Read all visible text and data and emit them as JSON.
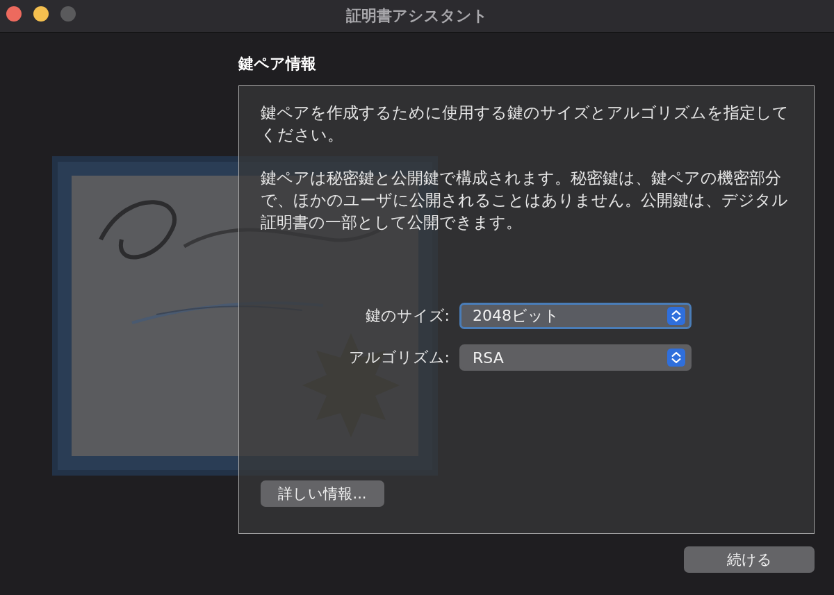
{
  "window": {
    "title": "証明書アシスタント"
  },
  "heading": "鍵ペア情報",
  "paragraphs": [
    "鍵ペアを作成するために使用する鍵のサイズとアルゴリズムを指定してください。",
    "鍵ペアは秘密鍵と公開鍵で構成されます。秘密鍵は、鍵ペアの機密部分で、ほかのユーザに公開されることはありません。公開鍵は、デジタル証明書の一部として公開できます。"
  ],
  "fields": [
    {
      "label": "鍵のサイズ:",
      "value": "2048ビット",
      "focused": true
    },
    {
      "label": "アルゴリズム:",
      "value": "RSA",
      "focused": false
    }
  ],
  "details_button": "詳しい情報...",
  "continue_button": "続ける"
}
